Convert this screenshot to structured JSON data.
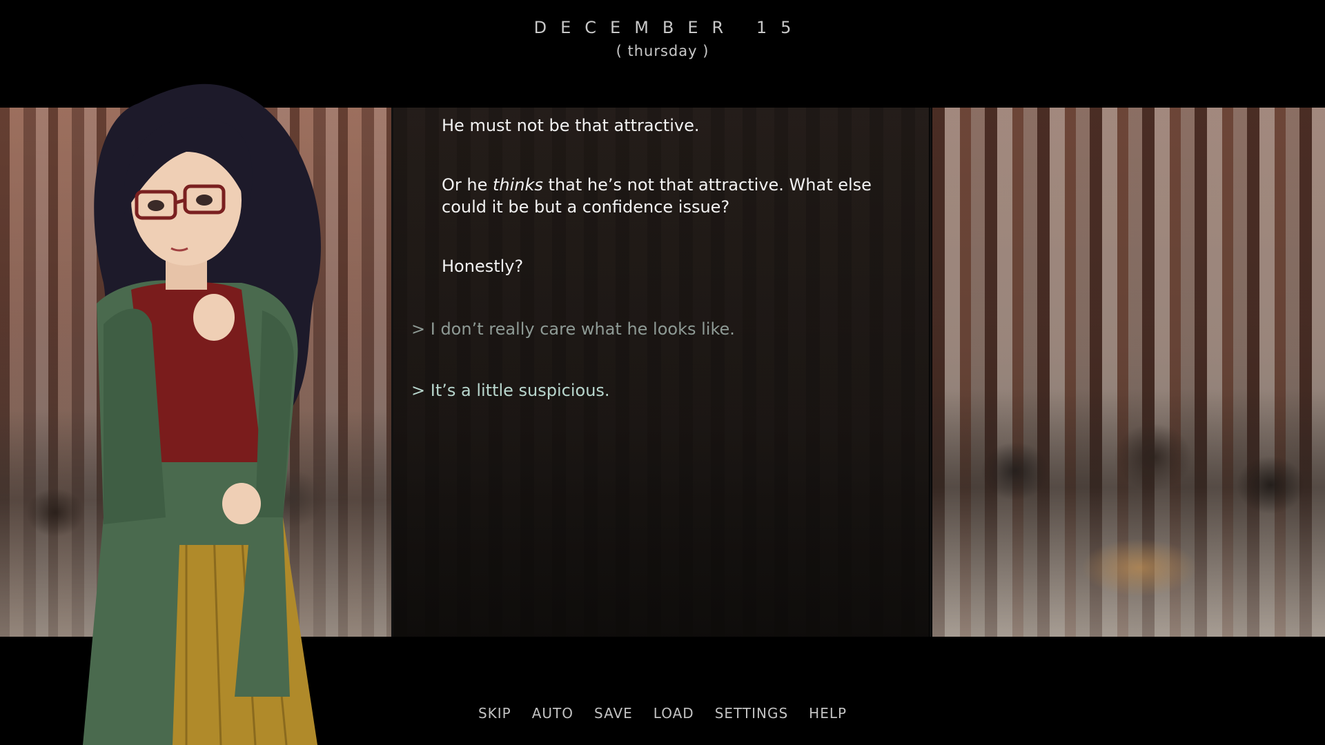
{
  "header": {
    "date": "DECEMBER 15",
    "weekday": "( thursday )"
  },
  "dialogue": {
    "line1": "He must not be that attractive.",
    "line2_prefix": "Or he ",
    "line2_emphasis": "thinks",
    "line2_suffix": " that he’s not that attractive. What else could it be but a confidence issue?",
    "line3": "Honestly?"
  },
  "choices": [
    {
      "label": "> I don’t really care what he looks like.",
      "color": "#8e9a95"
    },
    {
      "label": "> It’s a little suspicious.",
      "color": "#b8d6cd"
    }
  ],
  "quick_menu": {
    "skip": "SKIP",
    "auto": "AUTO",
    "save": "SAVE",
    "load": "LOAD",
    "settings": "SETTINGS",
    "help": "HELP"
  }
}
